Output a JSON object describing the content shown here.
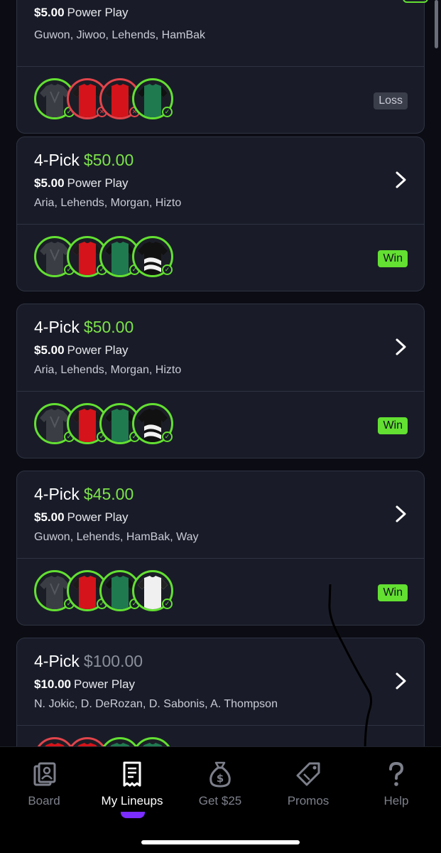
{
  "colors": {
    "accent_green": "#7de34a",
    "win": "#63e032",
    "loss_red": "#e2444b",
    "tab_active_indicator": "#7b2cff"
  },
  "lineups": [
    {
      "title": "",
      "amount": "",
      "entry_amount": "$5.00",
      "entry_type": "Power Play",
      "players": "Guwon, Jiwoo, Lehends, HamBak",
      "jerseys": [
        "gray-check",
        "red-loss",
        "red-loss",
        "green-check"
      ],
      "result": "Loss"
    },
    {
      "title": "4-Pick",
      "amount": "$50.00",
      "entry_amount": "$5.00",
      "entry_type": "Power Play",
      "players": "Aria, Lehends, Morgan, Hizto",
      "jerseys": [
        "gray-check",
        "red-check",
        "green-check",
        "black-white-check"
      ],
      "result": "Win"
    },
    {
      "title": "4-Pick",
      "amount": "$50.00",
      "entry_amount": "$5.00",
      "entry_type": "Power Play",
      "players": "Aria, Lehends, Morgan, Hizto",
      "jerseys": [
        "gray-check",
        "red-check",
        "green-check",
        "black-white-check"
      ],
      "result": "Win"
    },
    {
      "title": "4-Pick",
      "amount": "$45.00",
      "entry_amount": "$5.00",
      "entry_type": "Power Play",
      "players": "Guwon, Lehends, HamBak, Way",
      "jerseys": [
        "gray-check",
        "red-check",
        "green-check",
        "white-check"
      ],
      "result": "Win"
    },
    {
      "title": "4-Pick",
      "amount": "$100.00",
      "entry_amount": "$10.00",
      "entry_type": "Power Play",
      "players": "N. Jokic, D. DeRozan, D. Sabonis, A. Thompson",
      "jerseys": [
        "red",
        "red",
        "green",
        "green"
      ],
      "result": ""
    }
  ],
  "tabs": [
    {
      "label": "Board",
      "icon": "board-icon",
      "active": false
    },
    {
      "label": "My Lineups",
      "icon": "receipt-icon",
      "active": true
    },
    {
      "label": "Get $25",
      "icon": "money-bag-icon",
      "active": false
    },
    {
      "label": "Promos",
      "icon": "tag-icon",
      "active": false
    },
    {
      "label": "Help",
      "icon": "question-icon",
      "active": false
    }
  ]
}
